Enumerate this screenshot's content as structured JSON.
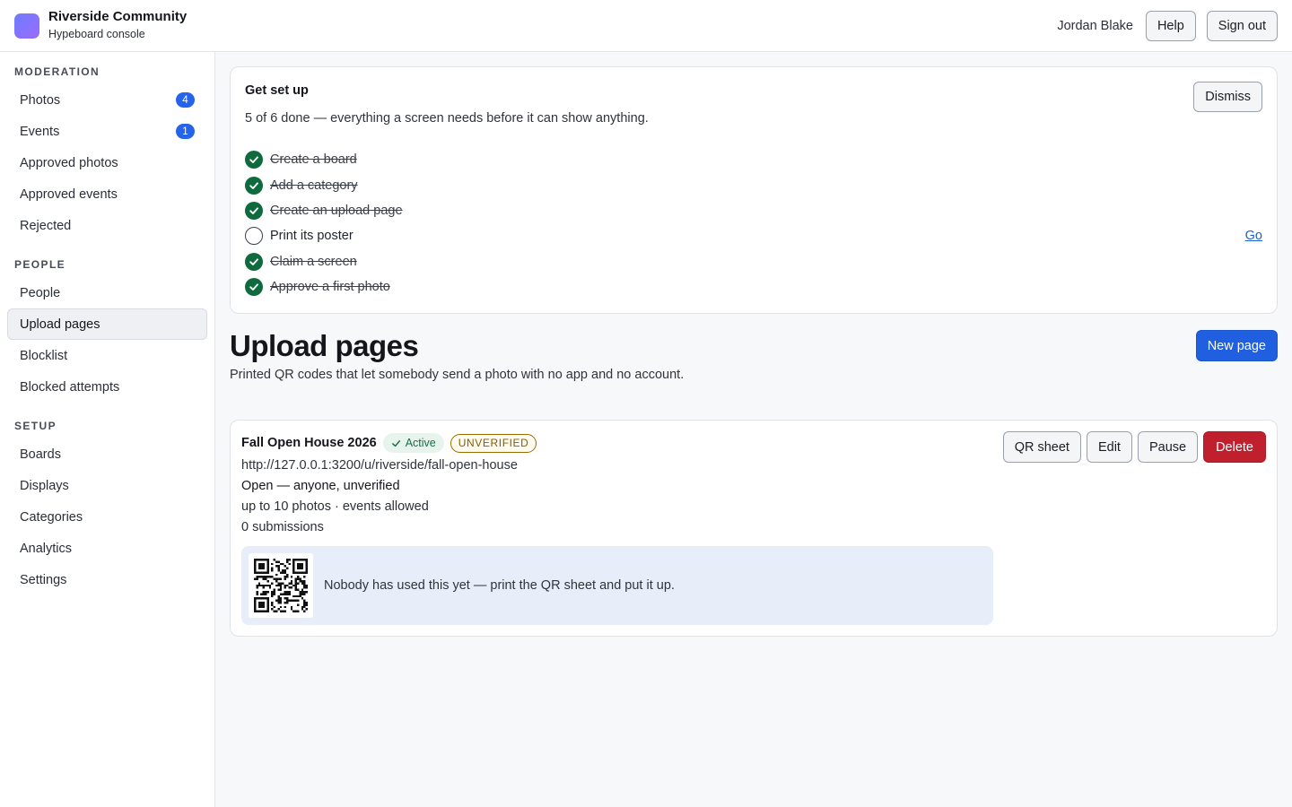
{
  "header": {
    "org_name": "Riverside Community",
    "app_name": "Hypeboard console",
    "user_name": "Jordan Blake",
    "help_label": "Help",
    "signout_label": "Sign out",
    "logo_color": "#7b74ff"
  },
  "sidebar": {
    "sections": [
      {
        "heading": "MODERATION",
        "items": [
          {
            "label": "Photos",
            "badge": "4"
          },
          {
            "label": "Events",
            "badge": "1"
          },
          {
            "label": "Approved photos"
          },
          {
            "label": "Approved events"
          },
          {
            "label": "Rejected"
          }
        ]
      },
      {
        "heading": "PEOPLE",
        "items": [
          {
            "label": "People"
          },
          {
            "label": "Upload pages",
            "active": true
          },
          {
            "label": "Blocklist"
          },
          {
            "label": "Blocked attempts"
          }
        ]
      },
      {
        "heading": "SETUP",
        "items": [
          {
            "label": "Boards"
          },
          {
            "label": "Displays"
          },
          {
            "label": "Categories"
          },
          {
            "label": "Analytics"
          },
          {
            "label": "Settings"
          }
        ]
      }
    ]
  },
  "setup": {
    "title": "Get set up",
    "subtitle": "5 of 6 done — everything a screen needs before it can show anything.",
    "dismiss_label": "Dismiss",
    "go_label": "Go",
    "steps": [
      {
        "label": "Create a board",
        "done": true
      },
      {
        "label": "Add a category",
        "done": true
      },
      {
        "label": "Create an upload page",
        "done": true
      },
      {
        "label": "Print its poster",
        "done": false
      },
      {
        "label": "Claim a screen",
        "done": true
      },
      {
        "label": "Approve a first photo",
        "done": true
      }
    ]
  },
  "page": {
    "title": "Upload pages",
    "description": "Printed QR codes that let somebody send a photo with no app and no account.",
    "new_page_label": "New page"
  },
  "upload_page": {
    "title": "Fall Open House 2026",
    "status": "Active",
    "verification": "UNVERIFIED",
    "url": "http://127.0.0.1:3200/u/riverside/fall-open-house",
    "mode": "Open — anyone, unverified",
    "limits": "up to 10 photos · events allowed",
    "submissions": "0 submissions",
    "actions": {
      "qr_sheet": "QR sheet",
      "edit": "Edit",
      "pause": "Pause",
      "delete": "Delete"
    },
    "empty_message": "Nobody has used this yet — print the QR sheet and put it up."
  },
  "colors": {
    "primary": "#1f5fe0",
    "danger": "#c0202d",
    "success": "#0f6b3e",
    "warning": "#9a6a00"
  }
}
